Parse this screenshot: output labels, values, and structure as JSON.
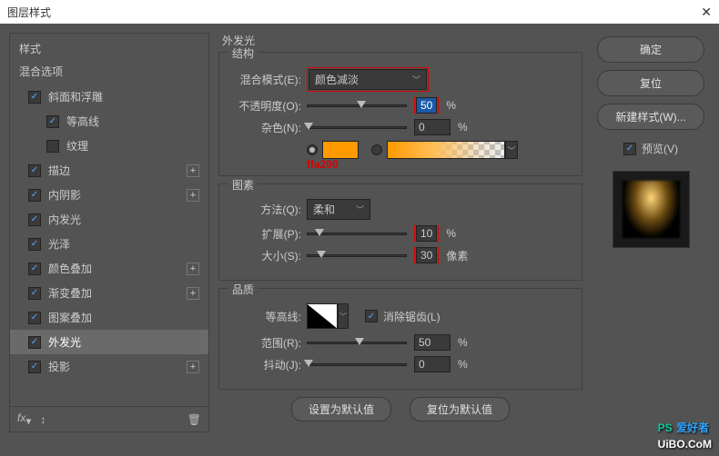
{
  "title": "图层样式",
  "left": {
    "style_label": "样式",
    "blend_options": "混合选项",
    "items": [
      {
        "label": "斜面和浮雕",
        "checked": true,
        "plus": false,
        "indent": false
      },
      {
        "label": "等高线",
        "checked": true,
        "plus": false,
        "indent": true
      },
      {
        "label": "纹理",
        "checked": false,
        "plus": false,
        "indent": true
      },
      {
        "label": "描边",
        "checked": true,
        "plus": true,
        "indent": false
      },
      {
        "label": "内阴影",
        "checked": true,
        "plus": true,
        "indent": false
      },
      {
        "label": "内发光",
        "checked": true,
        "plus": false,
        "indent": false
      },
      {
        "label": "光泽",
        "checked": true,
        "plus": false,
        "indent": false
      },
      {
        "label": "颜色叠加",
        "checked": true,
        "plus": true,
        "indent": false
      },
      {
        "label": "渐变叠加",
        "checked": true,
        "plus": true,
        "indent": false
      },
      {
        "label": "图案叠加",
        "checked": true,
        "plus": false,
        "indent": false
      },
      {
        "label": "外发光",
        "checked": true,
        "plus": false,
        "indent": false,
        "selected": true
      },
      {
        "label": "投影",
        "checked": true,
        "plus": true,
        "indent": false
      }
    ],
    "fx_label": "fx"
  },
  "center": {
    "panel_title": "外发光",
    "structure": {
      "title": "结构",
      "blend_mode_label": "混合模式(E):",
      "blend_mode_value": "颜色减淡",
      "opacity_label": "不透明度(O):",
      "opacity_value": "50",
      "opacity_unit": "%",
      "noise_label": "杂色(N):",
      "noise_value": "0",
      "noise_unit": "%",
      "swatch_color": "#ff9a00",
      "annotation": "ffa200"
    },
    "elements": {
      "title": "图素",
      "technique_label": "方法(Q):",
      "technique_value": "柔和",
      "spread_label": "扩展(P):",
      "spread_value": "10",
      "spread_unit": "%",
      "size_label": "大小(S):",
      "size_value": "30",
      "size_unit": "像素"
    },
    "quality": {
      "title": "品质",
      "contour_label": "等高线:",
      "antialias_label": "消除锯齿(L)",
      "range_label": "范围(R):",
      "range_value": "50",
      "range_unit": "%",
      "jitter_label": "抖动(J):",
      "jitter_value": "0",
      "jitter_unit": "%"
    },
    "default_btn": "设置为默认值",
    "reset_btn": "复位为默认值"
  },
  "right": {
    "ok": "确定",
    "reset": "复位",
    "new_style": "新建样式(W)...",
    "preview_label": "预览(V)"
  },
  "watermark": {
    "a": "PS",
    "b": "爱好者",
    "c": "UiBO.CoM"
  }
}
